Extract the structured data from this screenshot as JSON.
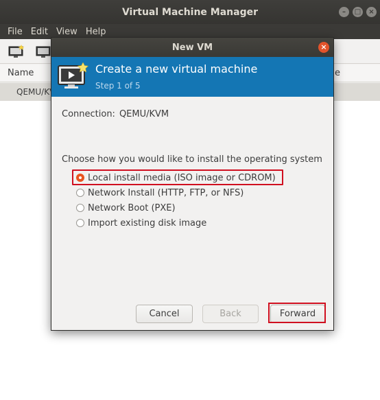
{
  "main_window": {
    "title": "Virtual Machine Manager",
    "menu": [
      "File",
      "Edit",
      "View",
      "Help"
    ],
    "list": {
      "columns": [
        "Name",
        "e"
      ],
      "rows": [
        "QEMU/KV"
      ]
    }
  },
  "dialog": {
    "title": "New VM",
    "header": {
      "title": "Create a new virtual machine",
      "step": "Step 1 of 5"
    },
    "connection": {
      "label": "Connection:",
      "value": "QEMU/KVM"
    },
    "install_question": "Choose how you would like to install the operating system",
    "options": [
      {
        "label": "Local install media (ISO image or CDROM)",
        "selected": true
      },
      {
        "label": "Network Install (HTTP, FTP, or NFS)",
        "selected": false
      },
      {
        "label": "Network Boot (PXE)",
        "selected": false
      },
      {
        "label": "Import existing disk image",
        "selected": false
      }
    ],
    "buttons": {
      "cancel": "Cancel",
      "back": "Back",
      "forward": "Forward"
    }
  },
  "colors": {
    "accent": "#e95420",
    "banner": "#1476b4",
    "highlight": "#d00f1f"
  }
}
